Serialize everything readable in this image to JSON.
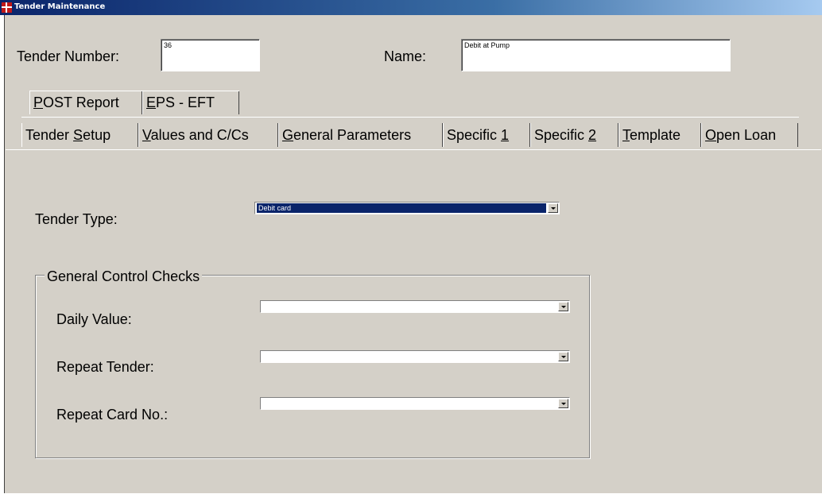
{
  "window": {
    "title": "Tender Maintenance",
    "icon": "app-grid-icon"
  },
  "header": {
    "tender_number_label": "Tender Number:",
    "tender_number_value": "36",
    "name_label": "Name:",
    "name_value": "Debit at Pump"
  },
  "tabs_row1": [
    "POST Report",
    "EPS - EFT"
  ],
  "tabs_row2": [
    "Tender Setup",
    "Values and C/Cs",
    "General Parameters",
    "Specific 1",
    "Specific 2",
    "Template",
    "Open Loan"
  ],
  "selected_tab": "Tender Setup",
  "tender_type": {
    "label": "Tender Type:",
    "value": "Debit card"
  },
  "group": {
    "title": "General Control Checks",
    "daily_value_label": "Daily Value:",
    "daily_value": "",
    "repeat_tender_label": "Repeat Tender:",
    "repeat_tender": "",
    "repeat_card_label": "Repeat Card No.:",
    "repeat_card": ""
  },
  "colors": {
    "face": "#d4d0c8",
    "title_start": "#0a246a",
    "selection": "#0a246a"
  }
}
